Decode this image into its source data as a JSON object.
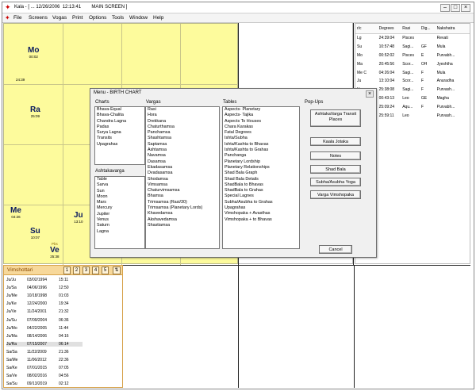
{
  "window": {
    "title": "Kala - [ ... 12/26/2006  12:13:41        MAIN SCREEN ]"
  },
  "menu": [
    "File",
    "Screens",
    "Vogas",
    "Print",
    "Options",
    "Tools",
    "Window",
    "Help"
  ],
  "chart": {
    "planets": [
      {
        "code": "",
        "abbr": "Mo",
        "deg": "00:02"
      },
      {
        "code": "",
        "abbr": "Ra",
        "deg": "25:09"
      },
      {
        "code": "",
        "abbr": "Me",
        "deg": "04:26"
      },
      {
        "code": "",
        "abbr": "Su",
        "deg": "10:07"
      },
      {
        "code": "",
        "abbr": "Ju",
        "deg": "13:10"
      },
      {
        "code": "Pbs",
        "abbr": "Ve",
        "deg": "25:38"
      }
    ],
    "cell_label": "24:39"
  },
  "planet_table": {
    "headers": [
      "r/c",
      "Degrees",
      "Rasi",
      "Dig...",
      "Nakshatra"
    ],
    "rows": [
      [
        "Lg",
        "24:39:04",
        "Pisces",
        "",
        "Revati"
      ],
      [
        "Su",
        "10:57:48",
        "Sagi...",
        "GF",
        "Mula"
      ],
      [
        "Mo",
        "00:52:02",
        "Pisces",
        "E",
        "Purvabh..."
      ],
      [
        "Ma",
        "20:45:56",
        "Scor...",
        "OH",
        "Jyeshtha"
      ],
      [
        "Me  C",
        "04:26:04",
        "Sagi...",
        "F",
        "Mula"
      ],
      [
        "Ju",
        "13:10:04",
        "Scor...",
        "F",
        "Anuradha"
      ],
      [
        "Ve",
        "25:38:08",
        "Sagi...",
        "F",
        "Purvash..."
      ],
      [
        "Sa",
        "00:43:13",
        "Leo",
        "GE",
        "Magha"
      ],
      [
        "Ra",
        "25:09:24",
        "Aqu...",
        "F",
        "Purvabh..."
      ],
      [
        "Ke",
        "25:59:11",
        "Leo",
        "",
        "Purvash..."
      ]
    ]
  },
  "dasha": {
    "title": "Vimshottari",
    "tabs": [
      "1",
      "2",
      "3",
      "4",
      "5"
    ],
    "rows": [
      [
        "Ju/Ju",
        "03/02/1994",
        "15:11"
      ],
      [
        "Ju/Sa",
        "04/06/1996",
        "12:50"
      ],
      [
        "Ju/Me",
        "10/18/1998",
        "01:03"
      ],
      [
        "Ju/Ke",
        "12/24/2000",
        "19:34"
      ],
      [
        "Ju/Ve",
        "11/24/2001",
        "21:32"
      ],
      [
        "Ju/Su",
        "07/09/2004",
        "06:36"
      ],
      [
        "Ju/Mo",
        "04/22/2005",
        "11:44"
      ],
      [
        "Ju/Ma",
        "08/14/2006",
        "04:16"
      ],
      [
        "Ju/Ra",
        "07/15/2007",
        "06:14"
      ],
      [
        "Sa/Sa",
        "11/22/2009",
        "21:36"
      ],
      [
        "Sa/Me",
        "11/06/2012",
        "22:36"
      ],
      [
        "Sa/Ke",
        "07/01/2015",
        "07:05"
      ],
      [
        "Sa/Ve",
        "08/02/2016",
        "04:56"
      ],
      [
        "Sa/Su",
        "09/13/2019",
        "02:12"
      ]
    ],
    "selected_index": 8
  },
  "dialog": {
    "title": "Menu - BIRTH CHART",
    "charts_label": "Charts",
    "charts": [
      "Bhava-Equal",
      "Bhava-Chalita",
      "Chandra Lagna",
      "Padas",
      "Surya Lagna",
      "Transits",
      "Upagrahas"
    ],
    "ashtaka_label": "Ashtakavarga",
    "ashtaka": [
      "Table",
      "Sarva",
      "Sun",
      "Moon",
      "Mars",
      "Mercury",
      "Jupiter",
      "Venus",
      "Saturn",
      "Lagna"
    ],
    "vargas_label": "Vargas",
    "vargas": [
      "Rasi",
      "Hora",
      "Drekkana",
      "Chaturthamsa",
      "Panchamsa",
      "Shashtamsa",
      "Saptamsa",
      "Ashtamsa",
      "Navamsa",
      "Dasamsa",
      "Ekadasamsa",
      "Dvadasamsa",
      "Shodamsa",
      "Vimsamsa",
      "Chaturvimsamsa",
      "Bhamsa",
      "Trimsamsa (Rasi/30)",
      "Trimsamsa (Planetary Lords)",
      "Khavedamsa",
      "Akshavedamsa",
      "Shastiamsa"
    ],
    "tables_label": "Tables",
    "tables": [
      "Aspects- Planetary",
      "Aspects- Tajika",
      "Aspects To Houses",
      "Chara Karakas",
      "Fatal Degrees",
      "Ishta/Subha",
      "Ishta/Kashta to Bhavas",
      "Ishta/Kashta to Grahas",
      "Panchanga",
      "Planetary Lordship",
      "Planetary Relationships",
      "Shad Bala Graph",
      "Shad Bala Details",
      "ShadBala to Bhavas",
      "ShadBala to Grahas",
      "Special Lagnes",
      "Subha/Asubha to Grahas",
      "Upagrahas",
      "Vimshopaka + Avasthas",
      "Vimshopaka + to Bhavas"
    ],
    "popups_label": "Pop-Ups",
    "popups": [
      "AshtakaVarga Transit Places",
      "Kaala Jotaka",
      "Notes",
      "Shad Bala",
      "Subha/Asubha Yoga",
      "Varga Vimshopaka"
    ],
    "cancel_label": "Cancel"
  }
}
